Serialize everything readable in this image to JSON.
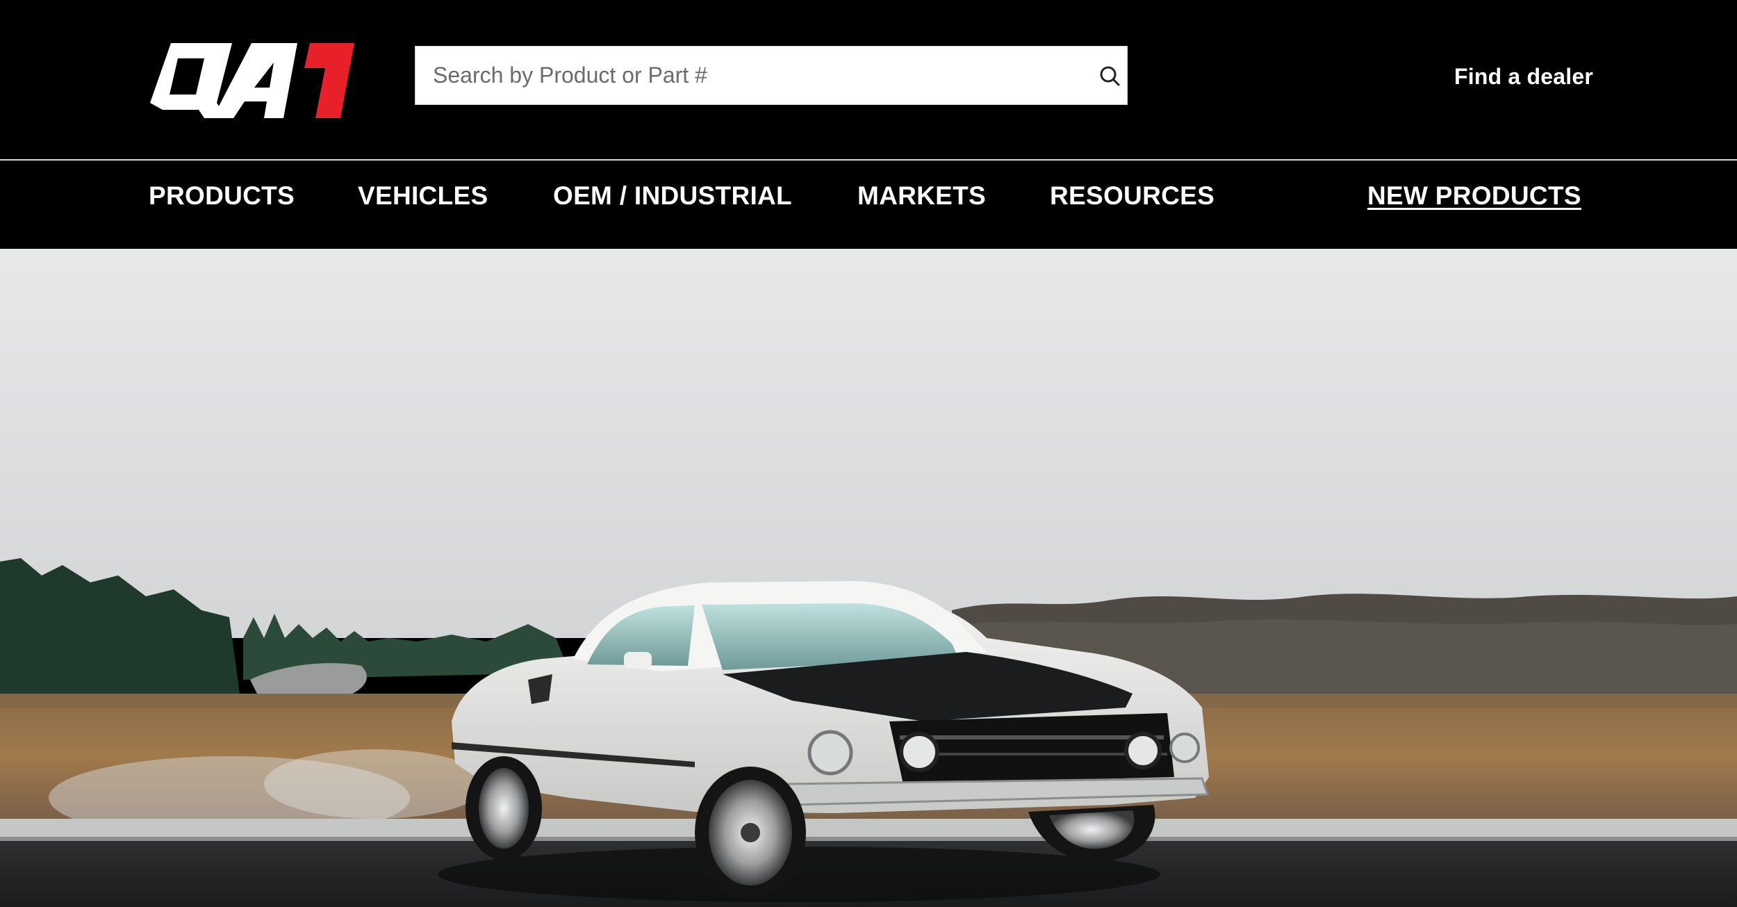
{
  "header": {
    "logo_text": "QA1",
    "search": {
      "placeholder": "Search by Product or Part #",
      "value": ""
    },
    "search_icon": "search-icon",
    "dealer_link": "Find a dealer"
  },
  "nav": {
    "items": [
      {
        "label": "PRODUCTS"
      },
      {
        "label": "VEHICLES"
      },
      {
        "label": "OEM / INDUSTRIAL"
      },
      {
        "label": "MARKETS"
      },
      {
        "label": "RESOURCES"
      }
    ],
    "new_products": "NEW PRODUCTS"
  },
  "colors": {
    "background": "#000000",
    "text": "#ffffff",
    "logo_accent": "#e8202a"
  }
}
